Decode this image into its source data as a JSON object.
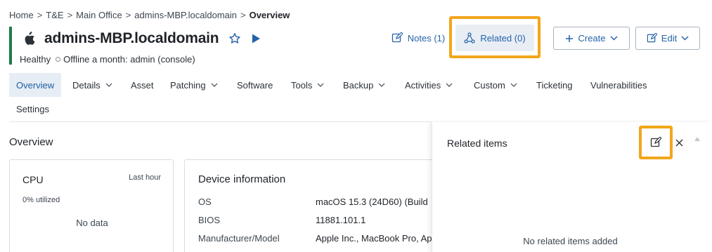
{
  "breadcrumb": [
    "Home",
    "T&E",
    "Main Office",
    "admins-MBP.localdomain",
    "Overview"
  ],
  "device": {
    "title": "admins-MBP.localdomain",
    "health": "Healthy",
    "status": "Offline a month: admin (console)"
  },
  "header_actions": {
    "notes_label": "Notes (1)",
    "related_label": "Related (0)",
    "create_label": "Create",
    "edit_label": "Edit"
  },
  "tabs": [
    {
      "label": "Overview",
      "active": true
    },
    {
      "label": "Details",
      "dropdown": true
    },
    {
      "label": "Asset"
    },
    {
      "label": "Patching",
      "dropdown": true
    },
    {
      "label": "Software"
    },
    {
      "label": "Tools",
      "dropdown": true
    },
    {
      "label": "Backup",
      "dropdown": true
    },
    {
      "label": "Activities",
      "dropdown": true
    },
    {
      "label": "Custom",
      "dropdown": true
    },
    {
      "label": "Ticketing"
    },
    {
      "label": "Vulnerabilities"
    },
    {
      "label": "Settings"
    }
  ],
  "overview": {
    "title": "Overview",
    "cpu": {
      "title": "CPU",
      "range": "Last hour",
      "utilization": "0% utilized",
      "empty": "No data"
    },
    "device_info": {
      "title": "Device information",
      "rows": [
        {
          "label": "OS",
          "value": "macOS 15.3 (24D60) (Build"
        },
        {
          "label": "BIOS",
          "value": "11881.101.1"
        },
        {
          "label": "Manufacturer/Model",
          "value": "Apple Inc., MacBook Pro, Ap"
        }
      ]
    }
  },
  "related_panel": {
    "title": "Related items",
    "empty": "No related items added"
  },
  "colors": {
    "accent_bar": "#1f7a4b",
    "link_blue": "#2563a8",
    "highlight": "#f2a61c",
    "active_tab_bg": "#e6edf5"
  },
  "icons": [
    "apple-icon",
    "star-icon",
    "play-icon",
    "notes-icon",
    "related-icon",
    "plus-icon",
    "chevron-down-icon",
    "edit-icon",
    "close-icon",
    "scroll-up-icon"
  ]
}
